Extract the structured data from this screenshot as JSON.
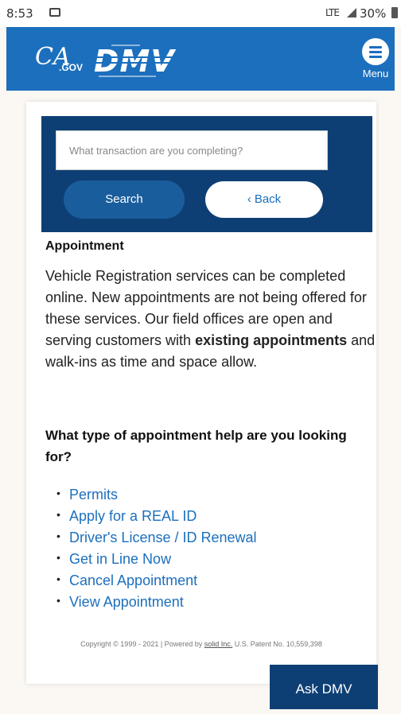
{
  "status": {
    "time": "8:53",
    "network": "LTE",
    "battery": "30%"
  },
  "header": {
    "cagov_ca": "CA",
    "cagov_gov": ".GOV",
    "dmv_logo": "DMV",
    "menu_label": "Menu"
  },
  "search": {
    "placeholder": "What transaction are you completing?",
    "search_label": "Search",
    "back_label": "Back"
  },
  "content": {
    "title": "Appointment",
    "para_1": "Vehicle Registration services can be completed online. New appointments are not being offered for these services. Our field offices are open and serving customers with ",
    "para_bold_1": "existing appointments",
    "para_2": " and walk-ins as time and space allow.",
    "question": "What type of appointment help are you looking for?",
    "links": [
      "Permits",
      "Apply for a REAL ID",
      "Driver's License / ID Renewal",
      "Get in Line Now",
      "Cancel Appointment",
      "View Appointment"
    ],
    "copyright_1": "Copyright © 1999 - 2021 | Powered by ",
    "copyright_link": "solid Inc.",
    "copyright_2": " U.S. Patent No. 10,559,398"
  },
  "ask_dmv": "Ask DMV",
  "colors": {
    "header_blue": "#1c6fbd",
    "navy": "#0e3f74",
    "link_blue": "#1c6fbd"
  }
}
